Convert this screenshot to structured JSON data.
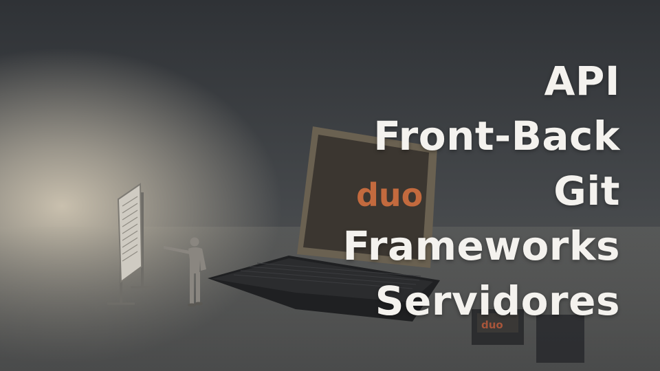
{
  "topics": [
    {
      "label": "API"
    },
    {
      "label": "Front-Back"
    },
    {
      "label": "Git"
    },
    {
      "label": "Frameworks"
    },
    {
      "label": "Servidores"
    }
  ],
  "laptop": {
    "logo_text": "duo"
  },
  "small_box": {
    "logo_text": "duo"
  }
}
